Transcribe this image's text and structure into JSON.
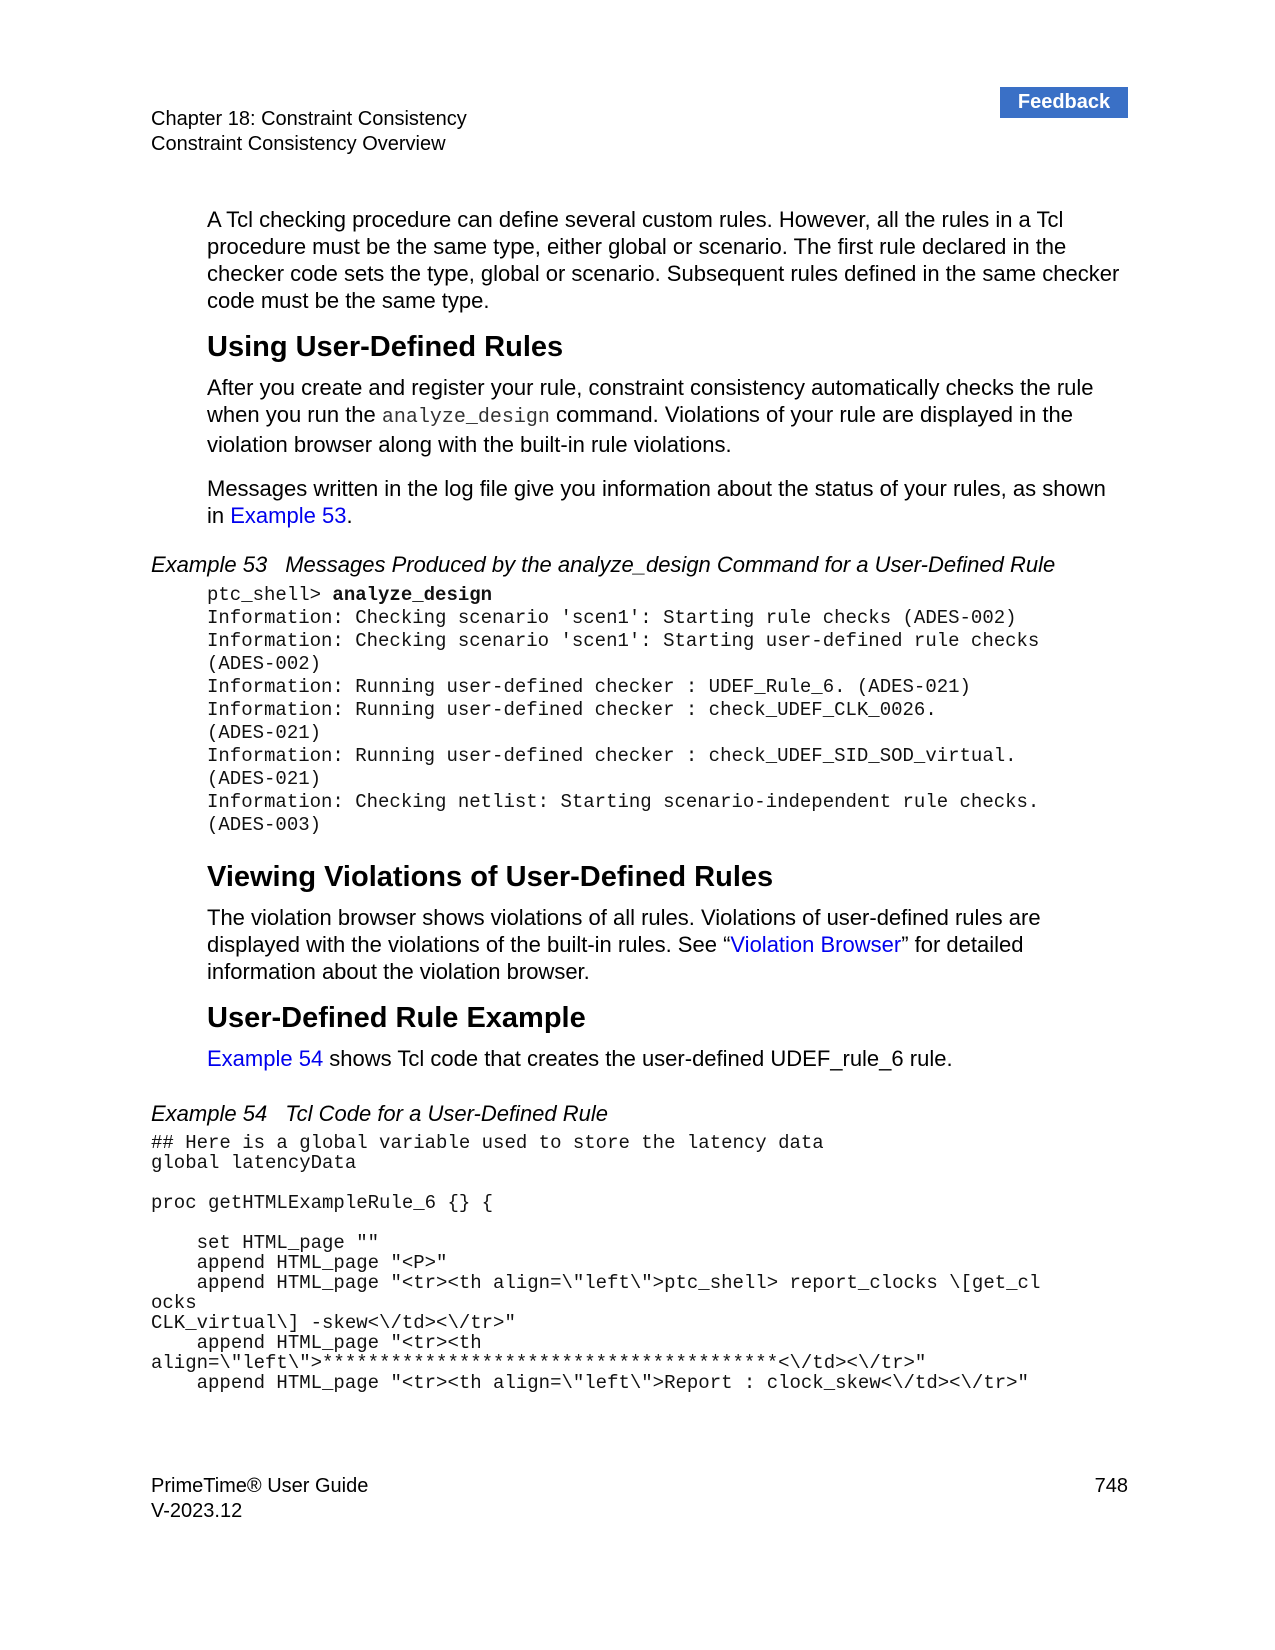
{
  "feedback_label": "Feedback",
  "header": {
    "chapter": "Chapter 18: Constraint Consistency",
    "section": "Constraint Consistency Overview"
  },
  "intro_paragraph": "A Tcl checking procedure can define several custom rules. However, all the rules in a Tcl procedure must be the same type, either global or scenario. The first rule declared in the checker code sets the type, global or scenario. Subsequent rules defined in the same checker code must be the same type.",
  "section_using": {
    "heading": "Using User-Defined Rules",
    "p1_before": "After you create and register your rule, constraint consistency automatically checks the rule when you run the ",
    "p1_code": "analyze_design",
    "p1_after": " command. Violations of your rule are displayed in the violation browser along with the built-in rule violations.",
    "p2_before": "Messages written in the log file give you information about the status of your rules, as shown in ",
    "p2_link": "Example 53",
    "p2_after": "."
  },
  "example53": {
    "number": "Example 53",
    "title": "Messages Produced by the analyze_design Command for a User-Defined Rule",
    "prompt": "ptc_shell> ",
    "command": "analyze_design",
    "output": "Information: Checking scenario 'scen1': Starting rule checks (ADES-002)\nInformation: Checking scenario 'scen1': Starting user-defined rule checks\n(ADES-002)\nInformation: Running user-defined checker : UDEF_Rule_6. (ADES-021)\nInformation: Running user-defined checker : check_UDEF_CLK_0026.\n(ADES-021)\nInformation: Running user-defined checker : check_UDEF_SID_SOD_virtual.\n(ADES-021)\nInformation: Checking netlist: Starting scenario-independent rule checks.\n(ADES-003)"
  },
  "section_viewing": {
    "heading": "Viewing Violations of User-Defined Rules",
    "p_before": "The violation browser shows violations of all rules. Violations of user-defined rules are displayed with the violations of the built-in rules. See “",
    "p_link": "Violation Browser",
    "p_after": "” for detailed information about the violation browser."
  },
  "section_example": {
    "heading": "User-Defined Rule Example",
    "p_link": "Example 54",
    "p_after": " shows Tcl code that creates the user-defined UDEF_rule_6 rule."
  },
  "example54": {
    "number": "Example 54",
    "title": "Tcl Code for a User-Defined Rule",
    "code": "## Here is a global variable used to store the latency data\nglobal latencyData\n\nproc getHTMLExampleRule_6 {} {\n\n    set HTML_page \"\"\n    append HTML_page \"<P>\"\n    append HTML_page \"<tr><th align=\\\"left\\\">ptc_shell> report_clocks \\[get_cl\nocks\nCLK_virtual\\] -skew<\\/td><\\/tr>\"\n    append HTML_page \"<tr><th\nalign=\\\"left\\\">****************************************<\\/td><\\/tr>\"\n    append HTML_page \"<tr><th align=\\\"left\\\">Report : clock_skew<\\/td><\\/tr>\""
  },
  "footer": {
    "title": "PrimeTime® User Guide",
    "version": "V-2023.12",
    "page": "748"
  }
}
